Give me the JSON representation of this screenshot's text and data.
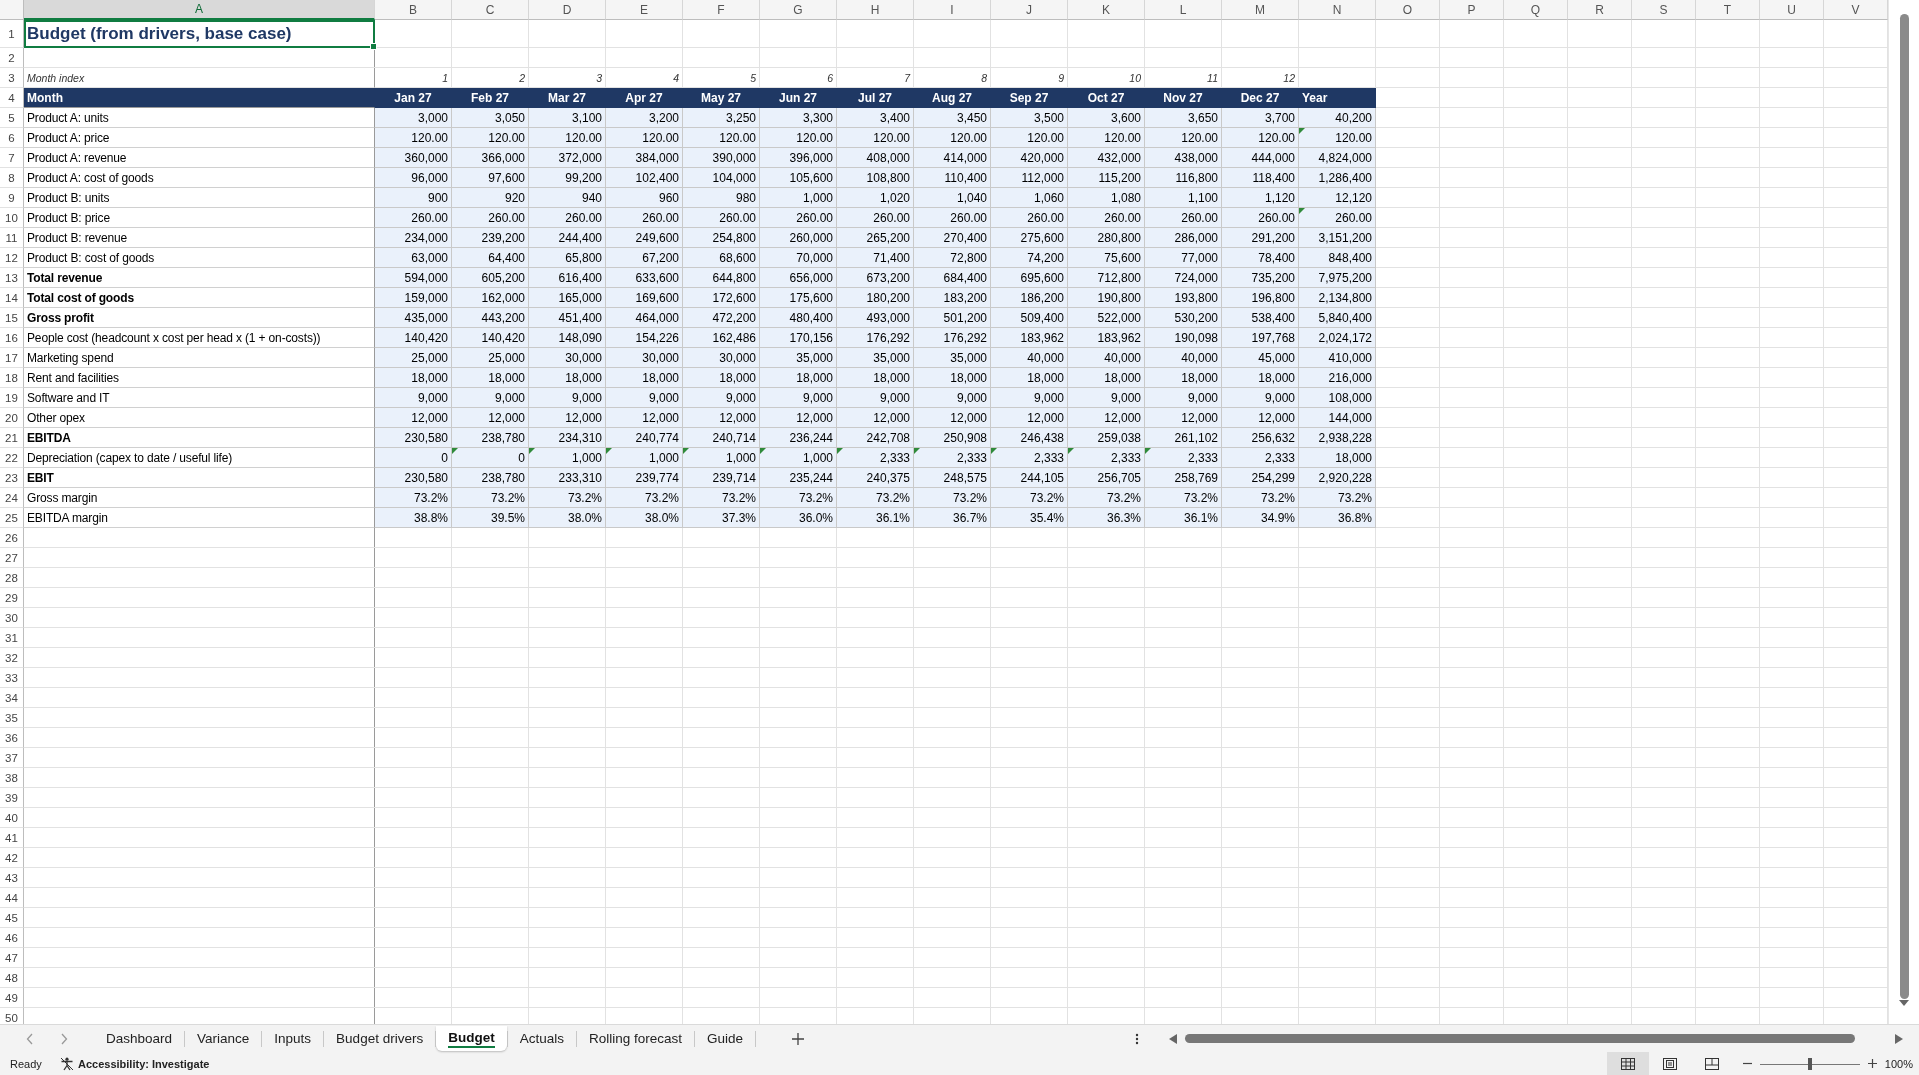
{
  "column_headers": [
    {
      "label": "A",
      "selected": true
    },
    {
      "label": "B",
      "selected": false
    },
    {
      "label": "C",
      "selected": false
    },
    {
      "label": "D",
      "selected": false
    },
    {
      "label": "E",
      "selected": false
    },
    {
      "label": "F",
      "selected": false
    },
    {
      "label": "G",
      "selected": false
    },
    {
      "label": "H",
      "selected": false
    },
    {
      "label": "I",
      "selected": false
    },
    {
      "label": "J",
      "selected": false
    },
    {
      "label": "K",
      "selected": false
    },
    {
      "label": "L",
      "selected": false
    },
    {
      "label": "M",
      "selected": false
    },
    {
      "label": "N",
      "selected": false
    },
    {
      "label": "O",
      "selected": false
    },
    {
      "label": "P",
      "selected": false
    },
    {
      "label": "Q",
      "selected": false
    },
    {
      "label": "R",
      "selected": false
    },
    {
      "label": "S",
      "selected": false
    },
    {
      "label": "T",
      "selected": false
    },
    {
      "label": "U",
      "selected": false
    },
    {
      "label": "V",
      "selected": false
    }
  ],
  "grid_rows": [
    {
      "row": "1",
      "kind": "title",
      "text": "Budget (from drivers, base case)",
      "selected": true
    },
    {
      "row": "2",
      "kind": "empty"
    },
    {
      "row": "3",
      "kind": "index",
      "label": "Month index",
      "values": [
        "1",
        "2",
        "3",
        "4",
        "5",
        "6",
        "7",
        "8",
        "9",
        "10",
        "11",
        "12"
      ]
    },
    {
      "row": "4",
      "kind": "header",
      "label": "Month",
      "values": [
        "Jan 27",
        "Feb 27",
        "Mar 27",
        "Apr 27",
        "May 27",
        "Jun 27",
        "Jul 27",
        "Aug 27",
        "Sep 27",
        "Oct 27",
        "Nov 27",
        "Dec 27",
        "Year"
      ]
    },
    {
      "row": "5",
      "kind": "data",
      "label": "Product A: units",
      "bold": false,
      "values": [
        "3,000",
        "3,050",
        "3,100",
        "3,200",
        "3,250",
        "3,300",
        "3,400",
        "3,450",
        "3,500",
        "3,600",
        "3,650",
        "3,700",
        "40,200"
      ]
    },
    {
      "row": "6",
      "kind": "data",
      "label": "Product A: price",
      "bold": false,
      "values": [
        "120.00",
        "120.00",
        "120.00",
        "120.00",
        "120.00",
        "120.00",
        "120.00",
        "120.00",
        "120.00",
        "120.00",
        "120.00",
        "120.00",
        "120.00"
      ],
      "flagged": [
        false,
        false,
        false,
        false,
        false,
        false,
        false,
        false,
        false,
        false,
        false,
        false,
        true
      ]
    },
    {
      "row": "7",
      "kind": "data",
      "label": "Product A: revenue",
      "bold": false,
      "values": [
        "360,000",
        "366,000",
        "372,000",
        "384,000",
        "390,000",
        "396,000",
        "408,000",
        "414,000",
        "420,000",
        "432,000",
        "438,000",
        "444,000",
        "4,824,000"
      ]
    },
    {
      "row": "8",
      "kind": "data",
      "label": "Product A: cost of goods",
      "bold": false,
      "values": [
        "96,000",
        "97,600",
        "99,200",
        "102,400",
        "104,000",
        "105,600",
        "108,800",
        "110,400",
        "112,000",
        "115,200",
        "116,800",
        "118,400",
        "1,286,400"
      ]
    },
    {
      "row": "9",
      "kind": "data",
      "label": "Product B: units",
      "bold": false,
      "values": [
        "900",
        "920",
        "940",
        "960",
        "980",
        "1,000",
        "1,020",
        "1,040",
        "1,060",
        "1,080",
        "1,100",
        "1,120",
        "12,120"
      ]
    },
    {
      "row": "10",
      "kind": "data",
      "label": "Product B: price",
      "bold": false,
      "values": [
        "260.00",
        "260.00",
        "260.00",
        "260.00",
        "260.00",
        "260.00",
        "260.00",
        "260.00",
        "260.00",
        "260.00",
        "260.00",
        "260.00",
        "260.00"
      ],
      "flagged": [
        false,
        false,
        false,
        false,
        false,
        false,
        false,
        false,
        false,
        false,
        false,
        false,
        true
      ]
    },
    {
      "row": "11",
      "kind": "data",
      "label": "Product B: revenue",
      "bold": false,
      "values": [
        "234,000",
        "239,200",
        "244,400",
        "249,600",
        "254,800",
        "260,000",
        "265,200",
        "270,400",
        "275,600",
        "280,800",
        "286,000",
        "291,200",
        "3,151,200"
      ]
    },
    {
      "row": "12",
      "kind": "data",
      "label": "Product B: cost of goods",
      "bold": false,
      "values": [
        "63,000",
        "64,400",
        "65,800",
        "67,200",
        "68,600",
        "70,000",
        "71,400",
        "72,800",
        "74,200",
        "75,600",
        "77,000",
        "78,400",
        "848,400"
      ]
    },
    {
      "row": "13",
      "kind": "data",
      "label": "Total revenue",
      "bold": true,
      "values": [
        "594,000",
        "605,200",
        "616,400",
        "633,600",
        "644,800",
        "656,000",
        "673,200",
        "684,400",
        "695,600",
        "712,800",
        "724,000",
        "735,200",
        "7,975,200"
      ]
    },
    {
      "row": "14",
      "kind": "data",
      "label": "Total cost of goods",
      "bold": true,
      "values": [
        "159,000",
        "162,000",
        "165,000",
        "169,600",
        "172,600",
        "175,600",
        "180,200",
        "183,200",
        "186,200",
        "190,800",
        "193,800",
        "196,800",
        "2,134,800"
      ]
    },
    {
      "row": "15",
      "kind": "data",
      "label": "Gross profit",
      "bold": true,
      "values": [
        "435,000",
        "443,200",
        "451,400",
        "464,000",
        "472,200",
        "480,400",
        "493,000",
        "501,200",
        "509,400",
        "522,000",
        "530,200",
        "538,400",
        "5,840,400"
      ]
    },
    {
      "row": "16",
      "kind": "data",
      "label": "People cost (headcount x cost per head x (1 + on-costs))",
      "bold": false,
      "values": [
        "140,420",
        "140,420",
        "148,090",
        "154,226",
        "162,486",
        "170,156",
        "176,292",
        "176,292",
        "183,962",
        "183,962",
        "190,098",
        "197,768",
        "2,024,172"
      ]
    },
    {
      "row": "17",
      "kind": "data",
      "label": "Marketing spend",
      "bold": false,
      "values": [
        "25,000",
        "25,000",
        "30,000",
        "30,000",
        "30,000",
        "35,000",
        "35,000",
        "35,000",
        "40,000",
        "40,000",
        "40,000",
        "45,000",
        "410,000"
      ]
    },
    {
      "row": "18",
      "kind": "data",
      "label": "Rent and facilities",
      "bold": false,
      "values": [
        "18,000",
        "18,000",
        "18,000",
        "18,000",
        "18,000",
        "18,000",
        "18,000",
        "18,000",
        "18,000",
        "18,000",
        "18,000",
        "18,000",
        "216,000"
      ]
    },
    {
      "row": "19",
      "kind": "data",
      "label": "Software and IT",
      "bold": false,
      "values": [
        "9,000",
        "9,000",
        "9,000",
        "9,000",
        "9,000",
        "9,000",
        "9,000",
        "9,000",
        "9,000",
        "9,000",
        "9,000",
        "9,000",
        "108,000"
      ]
    },
    {
      "row": "20",
      "kind": "data",
      "label": "Other opex",
      "bold": false,
      "values": [
        "12,000",
        "12,000",
        "12,000",
        "12,000",
        "12,000",
        "12,000",
        "12,000",
        "12,000",
        "12,000",
        "12,000",
        "12,000",
        "12,000",
        "144,000"
      ]
    },
    {
      "row": "21",
      "kind": "data",
      "label": "EBITDA",
      "bold": true,
      "values": [
        "230,580",
        "238,780",
        "234,310",
        "240,774",
        "240,714",
        "236,244",
        "242,708",
        "250,908",
        "246,438",
        "259,038",
        "261,102",
        "256,632",
        "2,938,228"
      ]
    },
    {
      "row": "22",
      "kind": "data",
      "label": "Depreciation (capex to date / useful life)",
      "bold": false,
      "values": [
        "0",
        "0",
        "1,000",
        "1,000",
        "1,000",
        "1,000",
        "2,333",
        "2,333",
        "2,333",
        "2,333",
        "2,333",
        "2,333",
        "18,000"
      ],
      "flagged": [
        false,
        true,
        true,
        true,
        true,
        true,
        true,
        true,
        true,
        true,
        true,
        false,
        false
      ]
    },
    {
      "row": "23",
      "kind": "data",
      "label": "EBIT",
      "bold": true,
      "values": [
        "230,580",
        "238,780",
        "233,310",
        "239,774",
        "239,714",
        "235,244",
        "240,375",
        "248,575",
        "244,105",
        "256,705",
        "258,769",
        "254,299",
        "2,920,228"
      ]
    },
    {
      "row": "24",
      "kind": "data",
      "label": "Gross margin",
      "bold": false,
      "values": [
        "73.2%",
        "73.2%",
        "73.2%",
        "73.2%",
        "73.2%",
        "73.2%",
        "73.2%",
        "73.2%",
        "73.2%",
        "73.2%",
        "73.2%",
        "73.2%",
        "73.2%"
      ]
    },
    {
      "row": "25",
      "kind": "data",
      "label": "EBITDA margin",
      "bold": false,
      "values": [
        "38.8%",
        "39.5%",
        "38.0%",
        "38.0%",
        "37.3%",
        "36.0%",
        "36.1%",
        "36.7%",
        "35.4%",
        "36.3%",
        "36.1%",
        "34.9%",
        "36.8%"
      ]
    },
    {
      "row": "26",
      "kind": "empty"
    },
    {
      "row": "27",
      "kind": "empty"
    },
    {
      "row": "28",
      "kind": "empty"
    },
    {
      "row": "29",
      "kind": "empty"
    },
    {
      "row": "30",
      "kind": "empty"
    },
    {
      "row": "31",
      "kind": "empty"
    },
    {
      "row": "32",
      "kind": "empty"
    },
    {
      "row": "33",
      "kind": "empty"
    },
    {
      "row": "34",
      "kind": "empty"
    },
    {
      "row": "35",
      "kind": "empty"
    },
    {
      "row": "36",
      "kind": "empty"
    },
    {
      "row": "37",
      "kind": "empty"
    },
    {
      "row": "38",
      "kind": "empty"
    },
    {
      "row": "39",
      "kind": "empty"
    },
    {
      "row": "40",
      "kind": "empty"
    },
    {
      "row": "41",
      "kind": "empty"
    },
    {
      "row": "42",
      "kind": "empty"
    },
    {
      "row": "43",
      "kind": "empty"
    },
    {
      "row": "44",
      "kind": "empty"
    },
    {
      "row": "45",
      "kind": "empty"
    },
    {
      "row": "46",
      "kind": "empty"
    },
    {
      "row": "47",
      "kind": "empty"
    },
    {
      "row": "48",
      "kind": "empty"
    },
    {
      "row": "49",
      "kind": "empty"
    },
    {
      "row": "50",
      "kind": "empty"
    }
  ],
  "sheet_tabs": [
    {
      "label": "Dashboard",
      "selected": false
    },
    {
      "label": "Variance",
      "selected": false
    },
    {
      "label": "Inputs",
      "selected": false
    },
    {
      "label": "Budget drivers",
      "selected": false
    },
    {
      "label": "Budget",
      "selected": true
    },
    {
      "label": "Actuals",
      "selected": false
    },
    {
      "label": "Rolling forecast",
      "selected": false
    },
    {
      "label": "Guide",
      "selected": false
    }
  ],
  "status_bar": {
    "mode": "Ready",
    "accessibility": "Accessibility: Investigate",
    "zoom_slider": {
      "level": 0.5
    },
    "zoom": "100%"
  }
}
